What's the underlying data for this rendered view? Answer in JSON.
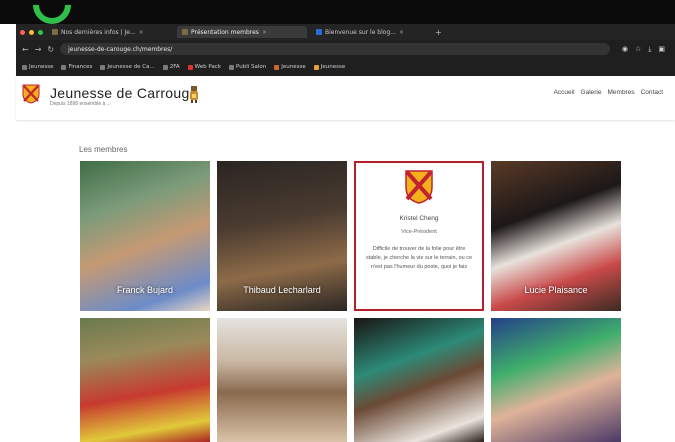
{
  "browser": {
    "tabs": [
      {
        "label": "Nos dernières infos | Je..."
      },
      {
        "label": "Présentation membres"
      },
      {
        "label": "Bienvenue sur le blog..."
      }
    ],
    "url": "jeunesse-de-carouge.ch/membres/",
    "bookmarks": [
      "Jeunesse",
      "Finances",
      "Jeunesse de Ca...",
      "2FA",
      "Web Pack",
      "Publi Salon",
      "Jeunesse",
      "Jeunesse"
    ]
  },
  "site": {
    "title": "Jeunesse de Carrouge",
    "subtitle": "Depuis 1898 ensemble à ...",
    "nav": [
      "Accueil",
      "Galerie",
      "Membres",
      "Contact"
    ]
  },
  "section": {
    "title": "Les membres"
  },
  "members": [
    {
      "name": "Franck Bujard"
    },
    {
      "name": "Thibaud Lecharlard"
    },
    {
      "name": "Kristel Cheng",
      "role": "Vice-Président",
      "bio": "Difficile de trouver de la folie pour être stable, je cherche la vie sur le terrain, ou ce n'est pas l'humeur du poste, quoi je fais"
    },
    {
      "name": "Lucie Plaisance"
    },
    {
      "name": ""
    },
    {
      "name": ""
    },
    {
      "name": ""
    },
    {
      "name": ""
    }
  ],
  "colors": {
    "accent": "#b61e2c",
    "shield_yellow": "#f2b01c",
    "shield_red": "#c2222f"
  }
}
